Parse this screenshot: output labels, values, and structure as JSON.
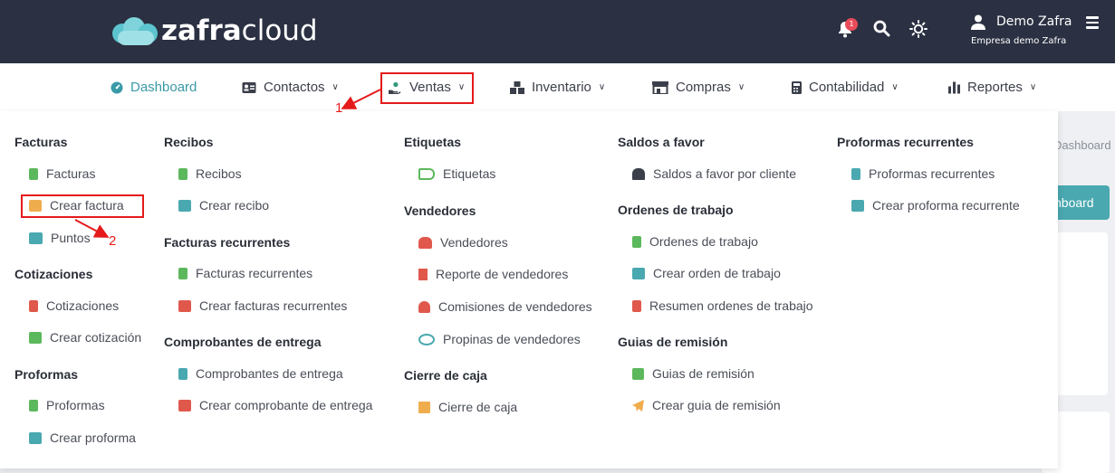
{
  "brand": {
    "logo_bold": "zafra",
    "logo_light": "cloud"
  },
  "header": {
    "notification_count": "1",
    "user_name": "Demo Zafra",
    "company": "Empresa demo Zafra"
  },
  "nav": {
    "dashboard": "Dashboard",
    "contactos": "Contactos",
    "ventas": "Ventas",
    "inventario": "Inventario",
    "compras": "Compras",
    "contabilidad": "Contabilidad",
    "reportes": "Reportes"
  },
  "background": {
    "crumb": "Dashboard",
    "button": "hboard"
  },
  "menu": {
    "col1": {
      "h1": "Facturas",
      "i1": "Facturas",
      "i2": "Crear factura",
      "i3": "Puntos",
      "h2": "Cotizaciones",
      "i4": "Cotizaciones",
      "i5": "Crear cotización",
      "h3": "Proformas",
      "i6": "Proformas",
      "i7": "Crear proforma"
    },
    "col2": {
      "h1": "Recibos",
      "i1": "Recibos",
      "i2": "Crear recibo",
      "h2": "Facturas recurrentes",
      "i3": "Facturas recurrentes",
      "i4": "Crear facturas recurrentes",
      "h3": "Comprobantes de entrega",
      "i5": "Comprobantes de entrega",
      "i6": "Crear comprobante de entrega"
    },
    "col3": {
      "h1": "Etiquetas",
      "i1": "Etiquetas",
      "h2": "Vendedores",
      "i2": "Vendedores",
      "i3": "Reporte de vendedores",
      "i4": "Comisiones de vendedores",
      "i5": "Propinas de vendedores",
      "h3": "Cierre de caja",
      "i6": "Cierre de caja"
    },
    "col4": {
      "h1": "Saldos a favor",
      "i1": "Saldos a favor por cliente",
      "h2": "Ordenes de trabajo",
      "i2": "Ordenes de trabajo",
      "i3": "Crear orden de trabajo",
      "i4": "Resumen ordenes de trabajo",
      "h3": "Guias de remisión",
      "i5": "Guias de remisión",
      "i6": "Crear guia de remisión"
    },
    "col5": {
      "h1": "Proformas recurrentes",
      "i1": "Proformas recurrentes",
      "i2": "Crear proforma recurrente"
    }
  },
  "annotations": {
    "step1": "1",
    "step2": "2"
  },
  "colors": {
    "topbar": "#2b3042",
    "accent": "#3a9aa8",
    "highlight": "#e51a1a"
  }
}
